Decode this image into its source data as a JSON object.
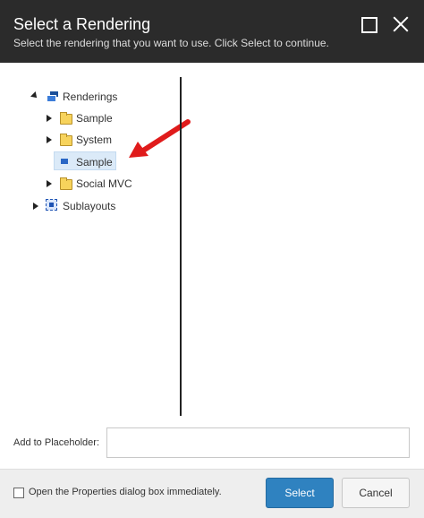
{
  "dialog": {
    "title": "Select a Rendering",
    "subtitle": "Select the rendering that you want to use. Click Select to continue.",
    "maximize_icon": "maximize-icon",
    "close_icon": "close-icon"
  },
  "tree": {
    "root": {
      "label": "Renderings",
      "icon": "renderings-icon",
      "expanded": true
    },
    "children": [
      {
        "label": "Sample",
        "icon": "folder-icon",
        "expanded": false
      },
      {
        "label": "System",
        "icon": "folder-icon",
        "expanded": false
      },
      {
        "label": "Sample",
        "icon": "rendering-icon",
        "selected": true
      },
      {
        "label": "Social MVC",
        "icon": "folder-icon",
        "expanded": false
      }
    ],
    "sublayouts": {
      "label": "Sublayouts",
      "icon": "sublayouts-icon",
      "expanded": false
    }
  },
  "annotation": {
    "arrow_color": "#e01b1b"
  },
  "placeholder": {
    "label": "Add to Placeholder:",
    "value": ""
  },
  "footer": {
    "checkbox_label": "Open the Properties dialog box immediately.",
    "checkbox_checked": false,
    "select_label": "Select",
    "cancel_label": "Cancel"
  },
  "colors": {
    "titlebar": "#2b2b2b",
    "accent": "#2f82c0",
    "selection": "#dbeaf8"
  }
}
